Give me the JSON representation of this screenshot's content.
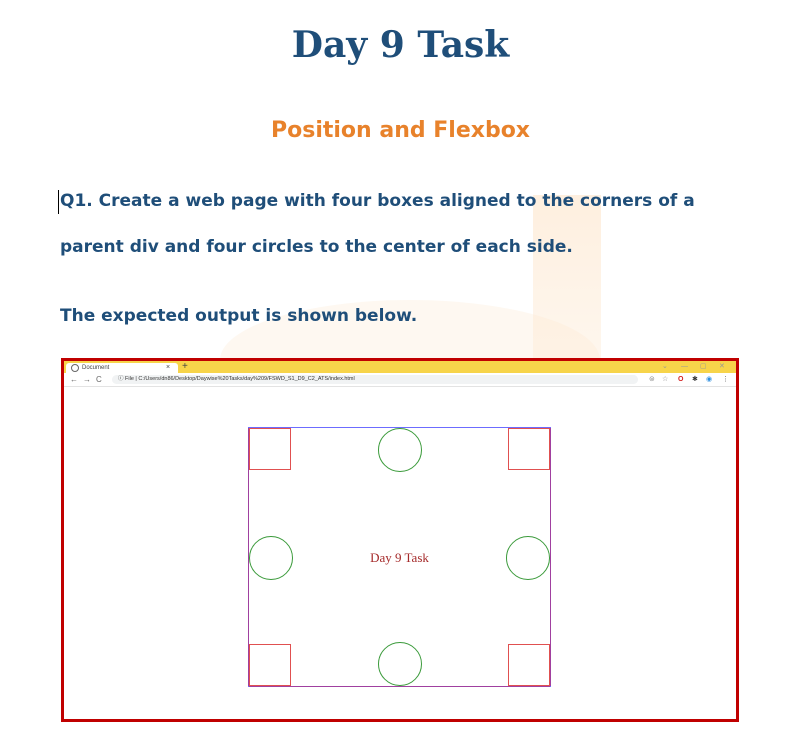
{
  "document": {
    "title": "Day 9 Task",
    "subtitle": "Position and Flexbox",
    "question_line1": "Q1. Create a web page with four boxes aligned to the corners of a",
    "question_line2": "parent div and four circles to the center of each side.",
    "expected_output": "The expected output is shown below."
  },
  "screenshot": {
    "tab_title": "Document",
    "tab_close": "×",
    "new_tab": "+",
    "window_controls": [
      "⌄",
      "—",
      "▢",
      "✕"
    ],
    "nav": {
      "back": "←",
      "forward": "→",
      "reload": "C",
      "info": "ⓘ"
    },
    "url_prefix": "File |",
    "url": "C:/Users/dn86/Desktop/Daywise%20Tasks/day%209/FSWD_S1_D9_C2_ATS/index.html",
    "extension_icons": [
      "⊜",
      "☆",
      "O",
      "✱",
      "◉",
      "⋮"
    ],
    "page_center_text": "Day 9 Task"
  },
  "colors": {
    "title": "#1f4e79",
    "subtitle": "#e8822b",
    "frame": "#c00000",
    "tabbar": "#f7d44a",
    "box_border": "#e05050",
    "circle_border": "#3a9a3a",
    "parent_border": "#6c6cff",
    "center_text": "#a52a2a"
  }
}
